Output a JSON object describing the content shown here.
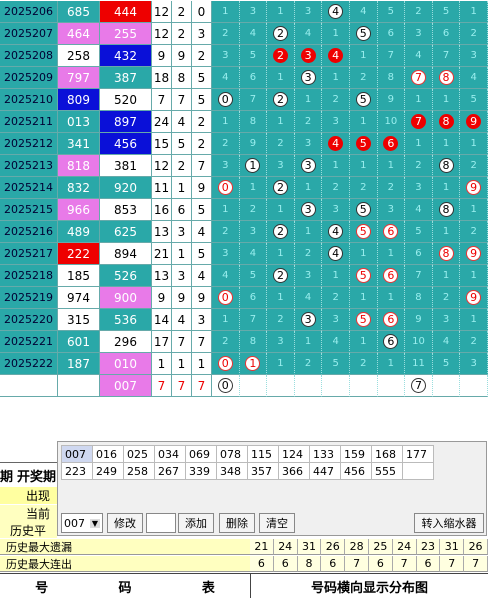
{
  "rows": [
    {
      "issue": "2025206",
      "a": "685",
      "ac": "bg-teal",
      "b": "444",
      "bc": "bg-red",
      "s": [
        "12",
        "2",
        "0"
      ],
      "d": [
        [
          "1",
          "n"
        ],
        [
          "3",
          "n"
        ],
        [
          "1",
          "n"
        ],
        [
          "3",
          "n"
        ],
        [
          "4",
          "w"
        ],
        [
          "4",
          "n"
        ],
        [
          "5",
          "n"
        ],
        [
          "2",
          "n"
        ],
        [
          "5",
          "n"
        ],
        [
          "1",
          "n"
        ]
      ]
    },
    {
      "issue": "2025207",
      "a": "464",
      "ac": "bg-mag",
      "b": "255",
      "bc": "bg-mag",
      "s": [
        "12",
        "2",
        "3"
      ],
      "d": [
        [
          "2",
          "n"
        ],
        [
          "4",
          "n"
        ],
        [
          "2",
          "w"
        ],
        [
          "4",
          "n"
        ],
        [
          "1",
          "n"
        ],
        [
          "5",
          "w"
        ],
        [
          "6",
          "n"
        ],
        [
          "3",
          "n"
        ],
        [
          "6",
          "n"
        ],
        [
          "2",
          "n"
        ]
      ]
    },
    {
      "issue": "2025208",
      "a": "258",
      "ac": "bg-white",
      "b": "432",
      "bc": "bg-blue",
      "s": [
        "9",
        "9",
        "2"
      ],
      "d": [
        [
          "3",
          "n"
        ],
        [
          "5",
          "n"
        ],
        [
          "2",
          "r"
        ],
        [
          "3",
          "r"
        ],
        [
          "4",
          "r"
        ],
        [
          "1",
          "n"
        ],
        [
          "7",
          "n"
        ],
        [
          "4",
          "n"
        ],
        [
          "7",
          "n"
        ],
        [
          "3",
          "n"
        ]
      ]
    },
    {
      "issue": "2025209",
      "a": "797",
      "ac": "bg-mag",
      "b": "387",
      "bc": "bg-teal",
      "s": [
        "18",
        "8",
        "5"
      ],
      "d": [
        [
          "4",
          "n"
        ],
        [
          "6",
          "n"
        ],
        [
          "1",
          "n"
        ],
        [
          "3",
          "w"
        ],
        [
          "1",
          "n"
        ],
        [
          "2",
          "n"
        ],
        [
          "8",
          "n"
        ],
        [
          "7",
          "o"
        ],
        [
          "8",
          "o"
        ],
        [
          "4",
          "n"
        ]
      ]
    },
    {
      "issue": "2025210",
      "a": "809",
      "ac": "bg-blue",
      "b": "520",
      "bc": "bg-white",
      "s": [
        "7",
        "7",
        "5"
      ],
      "d": [
        [
          "0",
          "w"
        ],
        [
          "7",
          "n"
        ],
        [
          "2",
          "w"
        ],
        [
          "1",
          "n"
        ],
        [
          "2",
          "n"
        ],
        [
          "5",
          "w"
        ],
        [
          "9",
          "n"
        ],
        [
          "1",
          "n"
        ],
        [
          "1",
          "n"
        ],
        [
          "5",
          "n"
        ]
      ]
    },
    {
      "issue": "2025211",
      "a": "013",
      "ac": "bg-teal",
      "b": "897",
      "bc": "bg-blue",
      "s": [
        "24",
        "4",
        "2"
      ],
      "d": [
        [
          "1",
          "n"
        ],
        [
          "8",
          "n"
        ],
        [
          "1",
          "n"
        ],
        [
          "2",
          "n"
        ],
        [
          "3",
          "n"
        ],
        [
          "1",
          "n"
        ],
        [
          "10",
          "n"
        ],
        [
          "7",
          "r"
        ],
        [
          "8",
          "r"
        ],
        [
          "9",
          "r"
        ]
      ]
    },
    {
      "issue": "2025212",
      "a": "341",
      "ac": "bg-teal",
      "b": "456",
      "bc": "bg-blue",
      "s": [
        "15",
        "5",
        "2"
      ],
      "d": [
        [
          "2",
          "n"
        ],
        [
          "9",
          "n"
        ],
        [
          "2",
          "n"
        ],
        [
          "3",
          "n"
        ],
        [
          "4",
          "r"
        ],
        [
          "5",
          "r"
        ],
        [
          "6",
          "r"
        ],
        [
          "1",
          "n"
        ],
        [
          "1",
          "n"
        ],
        [
          "1",
          "n"
        ]
      ]
    },
    {
      "issue": "2025213",
      "a": "818",
      "ac": "bg-mag",
      "b": "381",
      "bc": "bg-white",
      "s": [
        "12",
        "2",
        "7"
      ],
      "d": [
        [
          "3",
          "n"
        ],
        [
          "1",
          "w"
        ],
        [
          "3",
          "n"
        ],
        [
          "3",
          "w"
        ],
        [
          "1",
          "n"
        ],
        [
          "1",
          "n"
        ],
        [
          "1",
          "n"
        ],
        [
          "2",
          "n"
        ],
        [
          "8",
          "w"
        ],
        [
          "2",
          "n"
        ]
      ]
    },
    {
      "issue": "2025214",
      "a": "832",
      "ac": "bg-teal",
      "b": "920",
      "bc": "bg-teal",
      "s": [
        "11",
        "1",
        "9"
      ],
      "d": [
        [
          "0",
          "o"
        ],
        [
          "1",
          "n"
        ],
        [
          "2",
          "w"
        ],
        [
          "1",
          "n"
        ],
        [
          "2",
          "n"
        ],
        [
          "2",
          "n"
        ],
        [
          "2",
          "n"
        ],
        [
          "3",
          "n"
        ],
        [
          "1",
          "n"
        ],
        [
          "9",
          "o"
        ]
      ]
    },
    {
      "issue": "2025215",
      "a": "966",
      "ac": "bg-mag",
      "b": "853",
      "bc": "bg-white",
      "s": [
        "16",
        "6",
        "5"
      ],
      "d": [
        [
          "1",
          "n"
        ],
        [
          "2",
          "n"
        ],
        [
          "1",
          "n"
        ],
        [
          "3",
          "w"
        ],
        [
          "3",
          "n"
        ],
        [
          "5",
          "w"
        ],
        [
          "3",
          "n"
        ],
        [
          "4",
          "n"
        ],
        [
          "8",
          "w"
        ],
        [
          "1",
          "n"
        ]
      ]
    },
    {
      "issue": "2025216",
      "a": "489",
      "ac": "bg-teal",
      "b": "625",
      "bc": "bg-teal",
      "s": [
        "13",
        "3",
        "4"
      ],
      "d": [
        [
          "2",
          "n"
        ],
        [
          "3",
          "n"
        ],
        [
          "2",
          "w"
        ],
        [
          "1",
          "n"
        ],
        [
          "4",
          "w"
        ],
        [
          "5",
          "o"
        ],
        [
          "6",
          "o"
        ],
        [
          "5",
          "n"
        ],
        [
          "1",
          "n"
        ],
        [
          "2",
          "n"
        ]
      ]
    },
    {
      "issue": "2025217",
      "a": "222",
      "ac": "bg-red",
      "b": "894",
      "bc": "bg-white",
      "s": [
        "21",
        "1",
        "5"
      ],
      "d": [
        [
          "3",
          "n"
        ],
        [
          "4",
          "n"
        ],
        [
          "1",
          "n"
        ],
        [
          "2",
          "n"
        ],
        [
          "4",
          "w"
        ],
        [
          "1",
          "n"
        ],
        [
          "1",
          "n"
        ],
        [
          "6",
          "n"
        ],
        [
          "8",
          "o"
        ],
        [
          "9",
          "o"
        ]
      ]
    },
    {
      "issue": "2025218",
      "a": "185",
      "ac": "bg-white",
      "b": "526",
      "bc": "bg-teal",
      "s": [
        "13",
        "3",
        "4"
      ],
      "d": [
        [
          "4",
          "n"
        ],
        [
          "5",
          "n"
        ],
        [
          "2",
          "w"
        ],
        [
          "3",
          "n"
        ],
        [
          "1",
          "n"
        ],
        [
          "5",
          "o"
        ],
        [
          "6",
          "o"
        ],
        [
          "7",
          "n"
        ],
        [
          "1",
          "n"
        ],
        [
          "1",
          "n"
        ]
      ]
    },
    {
      "issue": "2025219",
      "a": "974",
      "ac": "bg-white",
      "b": "900",
      "bc": "bg-mag",
      "s": [
        "9",
        "9",
        "9"
      ],
      "d": [
        [
          "0",
          "o"
        ],
        [
          "6",
          "n"
        ],
        [
          "1",
          "n"
        ],
        [
          "4",
          "n"
        ],
        [
          "2",
          "n"
        ],
        [
          "1",
          "n"
        ],
        [
          "1",
          "n"
        ],
        [
          "8",
          "n"
        ],
        [
          "2",
          "n"
        ],
        [
          "9",
          "o"
        ]
      ]
    },
    {
      "issue": "2025220",
      "a": "315",
      "ac": "bg-white",
      "b": "536",
      "bc": "bg-teal",
      "s": [
        "14",
        "4",
        "3"
      ],
      "d": [
        [
          "1",
          "n"
        ],
        [
          "7",
          "n"
        ],
        [
          "2",
          "n"
        ],
        [
          "3",
          "w"
        ],
        [
          "3",
          "n"
        ],
        [
          "5",
          "o"
        ],
        [
          "6",
          "o"
        ],
        [
          "9",
          "n"
        ],
        [
          "3",
          "n"
        ],
        [
          "1",
          "n"
        ]
      ]
    },
    {
      "issue": "2025221",
      "a": "601",
      "ac": "bg-teal",
      "b": "296",
      "bc": "bg-white",
      "s": [
        "17",
        "7",
        "7"
      ],
      "d": [
        [
          "2",
          "n"
        ],
        [
          "8",
          "n"
        ],
        [
          "3",
          "n"
        ],
        [
          "1",
          "n"
        ],
        [
          "4",
          "n"
        ],
        [
          "1",
          "n"
        ],
        [
          "6",
          "w"
        ],
        [
          "10",
          "n"
        ],
        [
          "4",
          "n"
        ],
        [
          "2",
          "n"
        ]
      ]
    },
    {
      "issue": "2025222",
      "a": "187",
      "ac": "bg-teal",
      "b": "010",
      "bc": "bg-mag",
      "s": [
        "1",
        "1",
        "1"
      ],
      "d": [
        [
          "0",
          "o"
        ],
        [
          "1",
          "o"
        ],
        [
          "1",
          "n"
        ],
        [
          "2",
          "n"
        ],
        [
          "5",
          "n"
        ],
        [
          "2",
          "n"
        ],
        [
          "1",
          "n"
        ],
        [
          "11",
          "n"
        ],
        [
          "5",
          "n"
        ],
        [
          "3",
          "n"
        ]
      ]
    }
  ],
  "pending": {
    "b": "007",
    "s": [
      "7",
      "7",
      "7"
    ],
    "d": [
      [
        "0",
        "w"
      ],
      [
        "",
        "n"
      ],
      [
        "",
        "n"
      ],
      [
        "",
        "n"
      ],
      [
        "",
        "n"
      ],
      [
        "",
        "n"
      ],
      [
        "",
        "n"
      ],
      [
        "7",
        "w"
      ],
      [
        "",
        "n"
      ],
      [
        "",
        "n"
      ]
    ]
  },
  "panel": {
    "row1": [
      "007",
      "016",
      "025",
      "034",
      "069",
      "078",
      "115",
      "124",
      "133",
      "159",
      "168",
      "177"
    ],
    "row2": [
      "223",
      "249",
      "258",
      "267",
      "339",
      "348",
      "357",
      "366",
      "447",
      "456",
      "555",
      ""
    ],
    "select_value": "007",
    "modify": "修改",
    "add": "添加",
    "delete": "删除",
    "clear": "清空",
    "transfer": "转入缩水器"
  },
  "left_labels": {
    "period": "期",
    "open": "开奖期",
    "appear": "出现",
    "current": "当前",
    "hist_avg": "历史平"
  },
  "stats": [
    {
      "label": "历史最大遗漏",
      "vals": [
        "21",
        "24",
        "31",
        "26",
        "28",
        "25",
        "24",
        "23",
        "31",
        "26"
      ]
    },
    {
      "label": "历史最大连出",
      "vals": [
        "6",
        "6",
        "8",
        "6",
        "7",
        "6",
        "7",
        "6",
        "7",
        "7"
      ]
    }
  ],
  "footer": {
    "left_a": "号",
    "left_b": "码",
    "left_c": "表",
    "right": "号码横向显示分布图"
  }
}
